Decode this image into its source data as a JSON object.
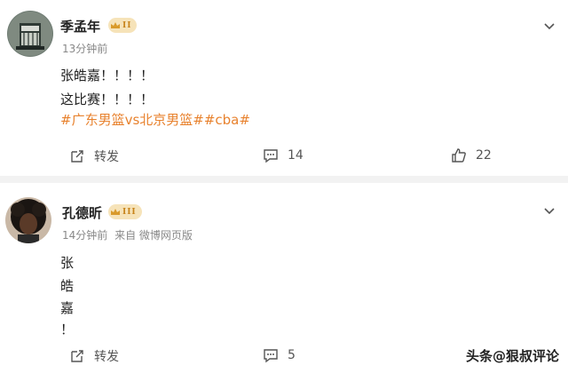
{
  "posts": [
    {
      "username": "季孟年",
      "badge": "II",
      "time": "13分钟前",
      "source": "",
      "lines": [
        "张皓嘉！！！！",
        "这比赛！！！！"
      ],
      "tags": "#广东男篮vs北京男篮##cba#",
      "actions": {
        "repost": "转发",
        "comments": "14",
        "likes": "22"
      }
    },
    {
      "username": "孔德昕",
      "badge": "III",
      "time": "14分钟前",
      "source": "来自 微博网页版",
      "lines": [
        "张",
        "皓",
        "嘉",
        "！"
      ],
      "actions": {
        "repost": "转发",
        "comments": "5"
      }
    }
  ],
  "watermark": "头条@狠叔评论",
  "colors": {
    "tag": "#e8822e",
    "meta": "#888888",
    "badge_bg": "#f6e3b9"
  },
  "icons": [
    "avatar",
    "crown-icon",
    "chevron-down-icon",
    "repost-icon",
    "comment-icon",
    "like-icon"
  ]
}
